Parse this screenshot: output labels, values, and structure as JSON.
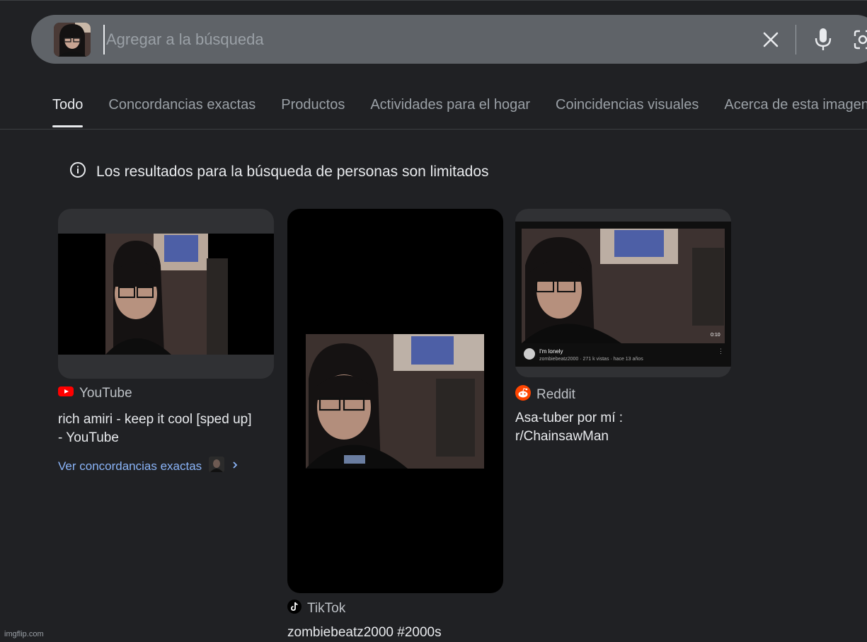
{
  "search": {
    "placeholder": "Agregar a la búsqueda",
    "query_image": "webcam-photo-girl-glasses"
  },
  "tabs": [
    {
      "label": "Todo",
      "active": true
    },
    {
      "label": "Concordancias exactas",
      "active": false
    },
    {
      "label": "Productos",
      "active": false
    },
    {
      "label": "Actividades para el hogar",
      "active": false
    },
    {
      "label": "Coincidencias visuales",
      "active": false
    },
    {
      "label": "Acerca de esta imagen",
      "active": false
    }
  ],
  "notice": {
    "icon": "info-icon",
    "text": "Los resultados para la búsqueda de personas son limitados"
  },
  "results": [
    {
      "source": "YouTube",
      "title_line1": "rich amiri - keep it cool [sped up]",
      "title_line2": "- YouTube",
      "exact_link": "Ver concordancias exactas"
    },
    {
      "source": "TikTok",
      "title_line1": "zombiebeatz2000 #2000s"
    },
    {
      "source": "Reddit",
      "title_line1": "Asa-tuber por mí :",
      "title_line2": "r/ChainsawMan",
      "thumb_overlay": {
        "duration": "0:10",
        "video_title": "I'm lonely",
        "video_meta": "zombiebeatz2000 · 271 k vistas · hace 13 años"
      }
    }
  ],
  "watermark": "imgflip.com",
  "colors": {
    "background": "#202124",
    "searchbar": "#5f6368",
    "link": "#8ab4f8",
    "youtube_red": "#ff0000",
    "reddit_orange": "#ff4500"
  }
}
